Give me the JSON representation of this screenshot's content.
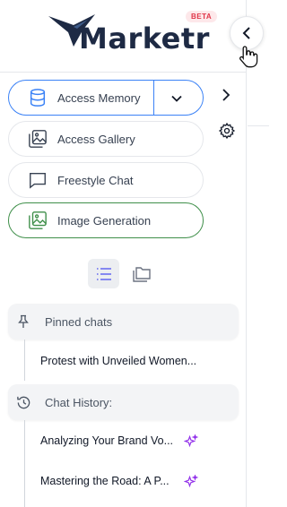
{
  "brand": {
    "name": "Marketr",
    "badge": "BETA"
  },
  "menu": [
    {
      "label": "Access Memory",
      "icon": "database-icon"
    },
    {
      "label": "Access Gallery",
      "icon": "gallery-icon"
    },
    {
      "label": "Freestyle Chat",
      "icon": "chat-bubble-icon"
    },
    {
      "label": "Image Generation",
      "icon": "image-generation-icon"
    }
  ],
  "pinned": {
    "title": "Pinned chats",
    "items": [
      "Protest with Unveiled Women..."
    ]
  },
  "history": {
    "title": "Chat History:",
    "items": [
      "Analyzing Your Brand Vo...",
      "Mastering the Road: A P..."
    ]
  },
  "colors": {
    "memory_border": "#3b82f6",
    "image_generation_border": "#3f8f4a",
    "badge": "#e03548",
    "sparkle": "#9333ea",
    "logo": "#1e2a44"
  }
}
